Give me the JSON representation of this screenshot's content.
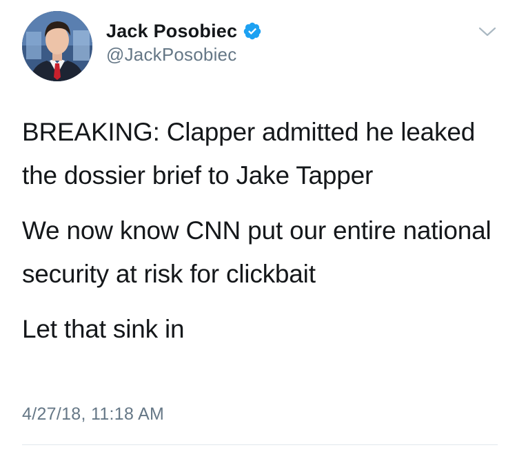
{
  "author": {
    "display_name": "Jack Posobiec",
    "handle": "@JackPosobiec",
    "verified": true
  },
  "tweet": {
    "paragraphs": [
      "BREAKING: Clapper admitted he leaked the dossier brief to Jake Tapper",
      "We now know CNN put our entire national security at risk for clickbait",
      "Let that sink in"
    ],
    "timestamp": "4/27/18, 11:18 AM"
  },
  "icons": {
    "verified": "verified-badge-icon",
    "menu": "chevron-down-icon"
  },
  "colors": {
    "verified_blue": "#1da1f2",
    "secondary_text": "#657786",
    "primary_text": "#14171a"
  }
}
